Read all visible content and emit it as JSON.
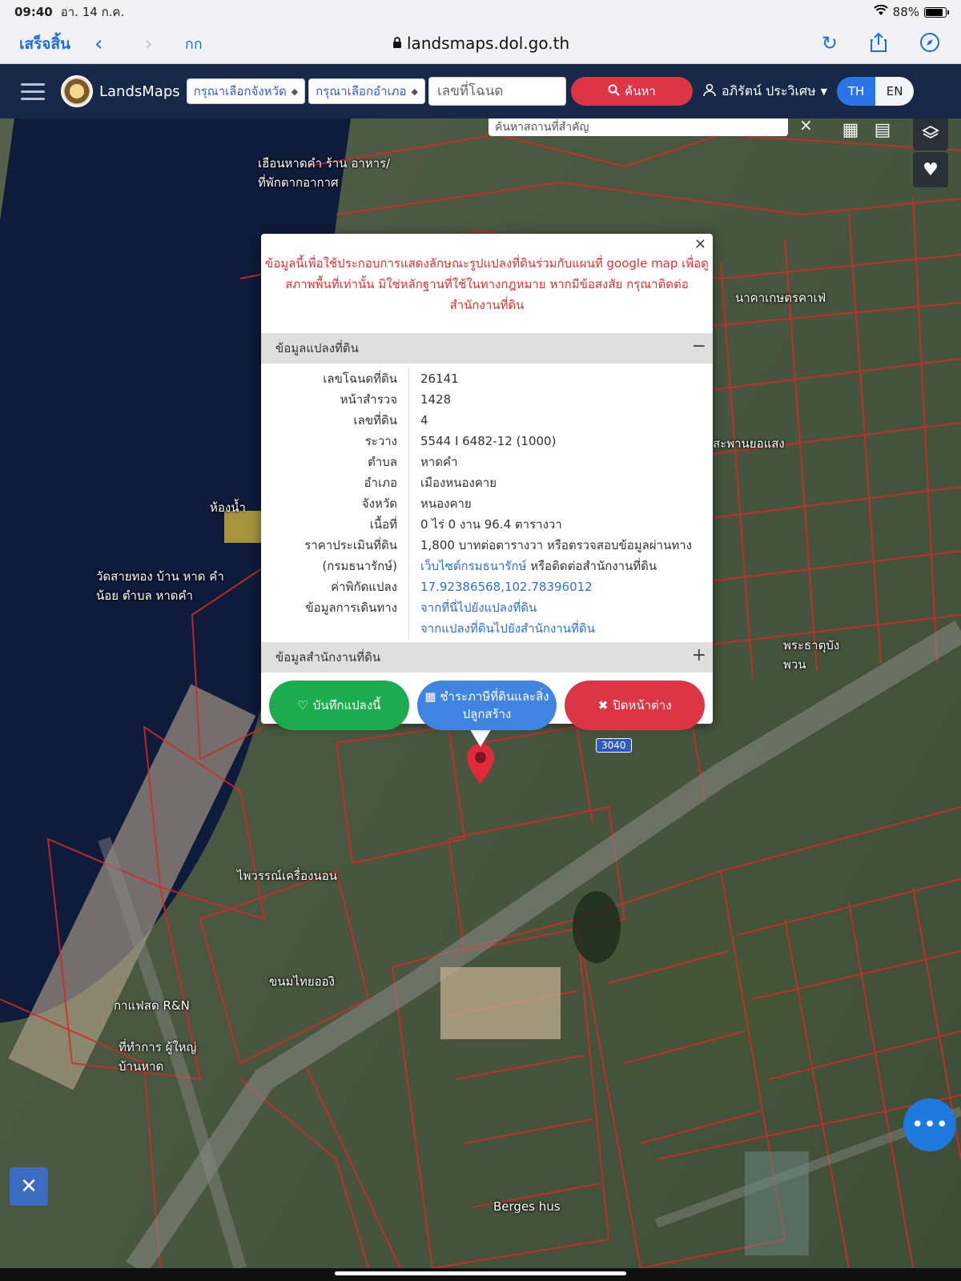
{
  "status_bar": {
    "time": "09:40",
    "date": "อา. 14 ก.ค.",
    "battery": "88%"
  },
  "browser": {
    "done_label": "เสร็จสิ้น",
    "text_size_label": "กก",
    "url": "landsmaps.dol.go.th"
  },
  "navbar": {
    "brand": "LandsMaps",
    "province_select": "กรุณาเลือกจังหวัด",
    "district_select": "กรุณาเลือกอำเภอ",
    "deed_placeholder": "เลขที่โฉนด",
    "search_label": "ค้นหา",
    "user_name": "อภิรัตน์ ประวิเศษ",
    "lang_th": "TH",
    "lang_en": "EN"
  },
  "map": {
    "search_placeholder": "ค้นหาสถานที่สำคัญ",
    "road_badge": "3040",
    "labels": [
      {
        "text": "เฮือนหาดคำ ร้าน อาหาร/ที่พักตากอากาศ"
      },
      {
        "text": "ห้องน้ำ"
      },
      {
        "text": "วัดสายทอง บ้าน หาด คำน้อย ตำบล หาดคำ"
      },
      {
        "text": "นาคาเกษตรคาเฟ่"
      },
      {
        "text": "สะพานยอแสง"
      },
      {
        "text": "พระธาตุบังพวน"
      },
      {
        "text": "ไพวรรณ์เครื่องนอน"
      },
      {
        "text": "ขนมไทยอองิ"
      },
      {
        "text": "กาแฟสด R&N"
      },
      {
        "text": "ที่ทำการ ผู้ใหญ่บ้านหาด"
      },
      {
        "text": "Berges hus"
      }
    ]
  },
  "popup": {
    "warning": "ข้อมูลนี้เพื่อใช้ประกอบการแสดงลักษณะรูปแปลงที่ดินร่วมกับแผนที่ google map เพื่อดูสภาพพื้นที่เท่านั้น มิใช่หลักฐานที่ใช้ในทางกฎหมาย หากมีข้อสงสัย กรุณาติดต่อสำนักงานที่ดิน",
    "section_parcel": "ข้อมูลแปลงที่ดิน",
    "section_office": "ข้อมูลสำนักงานที่ดิน",
    "rows": [
      {
        "k": "เลขโฉนดที่ดิน",
        "v": "26141"
      },
      {
        "k": "หน้าสำรวจ",
        "v": "1428"
      },
      {
        "k": "เลขที่ดิน",
        "v": "4"
      },
      {
        "k": "ระวาง",
        "v": "5544 I 6482-12 (1000)"
      },
      {
        "k": "ตำบล",
        "v": "หาดคำ"
      },
      {
        "k": "อำเภอ",
        "v": "เมืองหนองคาย"
      },
      {
        "k": "จังหวัด",
        "v": "หนองคาย"
      },
      {
        "k": "เนื้อที่",
        "v": "0 ไร่ 0 งาน 96.4 ตารางวา"
      },
      {
        "k": "ราคาประเมินที่ดิน",
        "v": "1,800 บาทต่อตารางวา หรือตรวจสอบข้อมูลผ่านทาง"
      }
    ],
    "row_treasury_key": "(กรมธนารักษ์)",
    "row_treasury_link": "เว็บไซต์กรมธนารักษ์",
    "row_treasury_rest": " หรือติดต่อสำนักงานที่ดิน",
    "coord_key": "ค่าพิกัดแปลง",
    "coord_value": "17.92386568,102.78396012",
    "travel_key": "ข้อมูลการเดินทาง",
    "travel_link1": "จากที่นี่ไปยังแปลงที่ดิน",
    "travel_link2": "จากแปลงที่ดินไปยังสำนักงานที่ดิน",
    "btn_save": "บันทึกแปลงนี้",
    "btn_tax": "ชำระภาษีที่ดินและสิ่งปลูกสร้าง",
    "btn_close": "ปิดหน้าต่าง"
  }
}
